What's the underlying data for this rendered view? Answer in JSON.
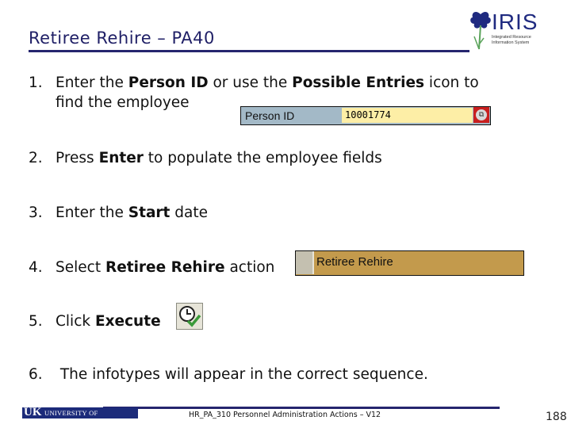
{
  "slide": {
    "title": "Retiree Rehire – PA40",
    "logo": {
      "name": "IRIS",
      "subtitle": "Integrated Resource Information System"
    }
  },
  "steps": [
    {
      "num": "1.",
      "parts": [
        {
          "text": "Enter the ",
          "bold": false
        },
        {
          "text": "Person ID",
          "bold": true
        },
        {
          "text": " or use the ",
          "bold": false
        },
        {
          "text": "Possible Entries",
          "bold": true
        },
        {
          "text": " icon to",
          "bold": false
        }
      ],
      "continuation": "find the employee"
    },
    {
      "num": "2.",
      "parts": [
        {
          "text": "Press ",
          "bold": false
        },
        {
          "text": "Enter",
          "bold": true
        },
        {
          "text": " to populate the employee fields",
          "bold": false
        }
      ]
    },
    {
      "num": "3.",
      "parts": [
        {
          "text": "Enter the ",
          "bold": false
        },
        {
          "text": "Start",
          "bold": true
        },
        {
          "text": " date",
          "bold": false
        }
      ]
    },
    {
      "num": "4.",
      "parts": [
        {
          "text": "Select ",
          "bold": false
        },
        {
          "text": "Retiree Rehire",
          "bold": true
        },
        {
          "text": " action",
          "bold": false
        }
      ]
    },
    {
      "num": "5.",
      "parts": [
        {
          "text": "Click ",
          "bold": false
        },
        {
          "text": "Execute",
          "bold": true
        }
      ]
    },
    {
      "num": "6.",
      "parts": [
        {
          "text": " The infotypes will appear in the correct sequence.",
          "bold": false
        }
      ]
    }
  ],
  "person_id_field": {
    "label": "Person ID",
    "value": "10001774",
    "possible_entries_icon": "possible-entries-icon"
  },
  "action_field": {
    "value": "Retiree Rehire"
  },
  "execute_button": {
    "icon": "clock-checkmark-icon"
  },
  "footer": {
    "university": "UNIVERSITY OF KENTUCKY",
    "university_mark": "UK",
    "course": "HR_PA_310 Personnel Administration Actions – V12",
    "page": "188"
  },
  "colors": {
    "title": "#1f1f66",
    "rule": "#25256e",
    "person_id_bg": "#a3b9c7",
    "input_bg": "#fdeea6",
    "action_bg": "#c39a4c"
  }
}
